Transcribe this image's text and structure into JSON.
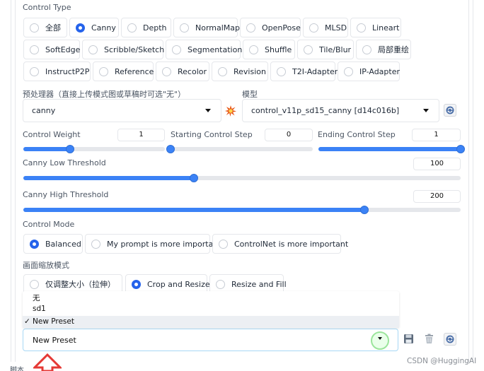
{
  "control_type": {
    "label": "Control Type",
    "selected": "Canny",
    "row1": [
      "全部",
      "Canny",
      "Depth",
      "NormalMap",
      "OpenPose",
      "MLSD",
      "Lineart"
    ],
    "row2": [
      "SoftEdge",
      "Scribble/Sketch",
      "Segmentation",
      "Shuffle",
      "Tile/Blur",
      "局部重绘"
    ],
    "row3": [
      "InstructP2P",
      "Reference",
      "Recolor",
      "Revision",
      "T2I-Adapter",
      "IP-Adapter"
    ]
  },
  "preprocessor": {
    "label": "预处理器（直接上传模式图或草稿时可选\"无\"）",
    "value": "canny"
  },
  "model": {
    "label": "模型",
    "value": "control_v11p_sd15_canny [d14c016b]"
  },
  "sliders": {
    "control_weight": {
      "label": "Control Weight",
      "value": "1",
      "fraction": 0.33
    },
    "starting_step": {
      "label": "Starting Control Step",
      "value": "0",
      "fraction": 0.0
    },
    "ending_step": {
      "label": "Ending Control Step",
      "value": "1",
      "fraction": 1.0
    },
    "canny_low": {
      "label": "Canny Low Threshold",
      "value": "100",
      "fraction": 0.39
    },
    "canny_high": {
      "label": "Canny High Threshold",
      "value": "200",
      "fraction": 0.78
    }
  },
  "control_mode": {
    "label": "Control Mode",
    "options": [
      "Balanced",
      "My prompt is more important",
      "ControlNet is more important"
    ],
    "selected": "Balanced"
  },
  "resize_mode": {
    "label": "画面缩放模式",
    "options": [
      "仅调整大小（拉伸）",
      "Crop and Resize",
      "Resize and Fill"
    ],
    "selected": "Crop and Resize"
  },
  "preset": {
    "options": [
      "无",
      "sd1",
      "New Preset"
    ],
    "checked": "✓",
    "value": "New Preset"
  },
  "footer": {
    "section_label": "脚本",
    "watermark": "CSDN @HuggingAI"
  },
  "colors": {
    "accent": "#2563eb",
    "arrow": "#e53935",
    "explosion_icon": "#e8591a"
  }
}
